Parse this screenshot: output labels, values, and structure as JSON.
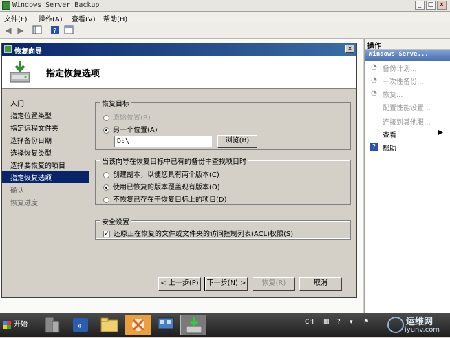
{
  "window": {
    "title": "Windows Server Backup",
    "minimize": "_",
    "maximize": "□",
    "close": "×"
  },
  "menu": [
    "文件(F)",
    "操作(A)",
    "查看(V)",
    "帮助(H)"
  ],
  "actions_panel": {
    "header": "操作",
    "subheader": "Windows Serve...",
    "items": [
      {
        "label": "备份计划...",
        "active": false
      },
      {
        "label": "一次性备份...",
        "active": false
      },
      {
        "label": "恢复...",
        "active": false
      },
      {
        "label": "配置性能设置...",
        "active": false
      },
      {
        "label": "连接到其他服...",
        "active": false
      },
      {
        "label": "查看",
        "active": true
      },
      {
        "label": "帮助",
        "active": true
      }
    ]
  },
  "dialog": {
    "title": "恢复向导",
    "close": "×",
    "heading": "指定恢复选项",
    "steps": [
      {
        "label": "入门",
        "state": "normal"
      },
      {
        "label": "指定位置类型",
        "state": "normal"
      },
      {
        "label": "指定远程文件夹",
        "state": "normal"
      },
      {
        "label": "选择备份日期",
        "state": "normal"
      },
      {
        "label": "选择恢复类型",
        "state": "normal"
      },
      {
        "label": "选择要恢复的项目",
        "state": "normal"
      },
      {
        "label": "指定恢复选项",
        "state": "selected"
      },
      {
        "label": "确认",
        "state": "dim"
      },
      {
        "label": "恢复进度",
        "state": "dim"
      }
    ],
    "target_group": {
      "legend": "恢复目标",
      "option_original": "原始位置(R)",
      "option_other": "另一个位置(A)",
      "path": "D:\\",
      "browse": "浏览(B)"
    },
    "conflict_group": {
      "legend": "当该向导在恢复目标中已有的备份中查找项目时",
      "options": [
        "创建副本，以便您具有两个版本(C)",
        "使用已恢复的版本覆盖现有版本(O)",
        "不恢复已存在于恢复目标上的项目(D)"
      ]
    },
    "security_group": {
      "legend": "安全设置",
      "checkbox": "还原正在恢复的文件或文件夹的访问控制列表(ACL)权限(S)"
    },
    "buttons": {
      "back": "< 上一步(P)",
      "next": "下一步(N) >",
      "recover": "恢复(R)",
      "cancel": "取消"
    }
  },
  "taskbar": {
    "start": "开始",
    "lang": "CH",
    "watermark_line1": "运维网",
    "watermark_line2": "iyunv.com"
  }
}
